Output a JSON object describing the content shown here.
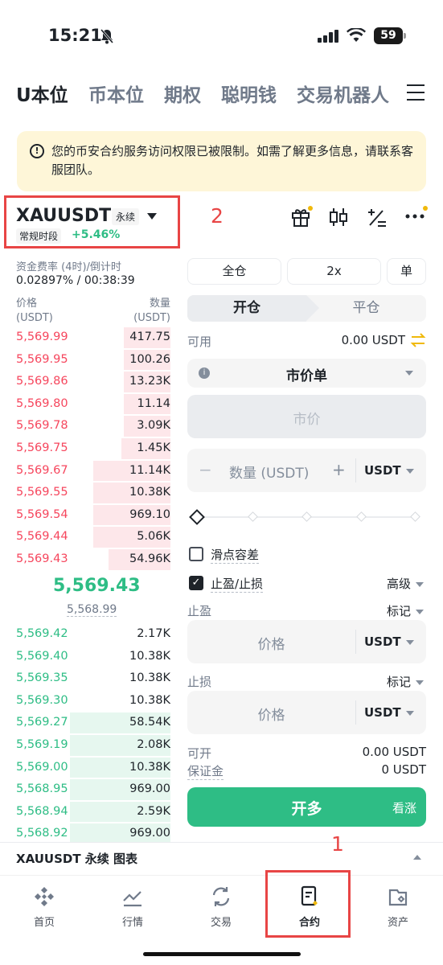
{
  "status_bar": {
    "time": "15:21",
    "battery": "59"
  },
  "top_tabs": [
    "U本位",
    "币本位",
    "期权",
    "聪明钱",
    "交易机器人"
  ],
  "notice": {
    "text": "您的币安合约服务访问权限已被限制。如需了解更多信息，请联系客服团队。"
  },
  "symbol": {
    "name": "XAUUSDT",
    "type": "永续",
    "session": "常规时段",
    "change": "+5.46%"
  },
  "annotations": {
    "label_2": "2",
    "label_1": "1"
  },
  "funding": {
    "label": "资金费率 (4时)/倒计时",
    "value": "0.02897% / 00:38:39"
  },
  "orderbook": {
    "price_header": "价格",
    "price_unit": "(USDT)",
    "qty_header": "数量",
    "qty_unit": "(USDT)",
    "asks": [
      {
        "price": "5,569.99",
        "qty": "417.75",
        "depth": 0.3
      },
      {
        "price": "5,569.95",
        "qty": "100.26",
        "depth": 0.3
      },
      {
        "price": "5,569.86",
        "qty": "13.23K",
        "depth": 0.3
      },
      {
        "price": "5,569.80",
        "qty": "11.14",
        "depth": 0.3
      },
      {
        "price": "5,569.78",
        "qty": "3.09K",
        "depth": 0.3
      },
      {
        "price": "5,569.75",
        "qty": "1.45K",
        "depth": 0.32
      },
      {
        "price": "5,569.67",
        "qty": "11.14K",
        "depth": 0.5
      },
      {
        "price": "5,569.55",
        "qty": "10.38K",
        "depth": 0.5
      },
      {
        "price": "5,569.54",
        "qty": "969.10",
        "depth": 0.5
      },
      {
        "price": "5,569.44",
        "qty": "5.06K",
        "depth": 0.5
      },
      {
        "price": "5,569.43",
        "qty": "54.96K",
        "depth": 0.4
      }
    ],
    "mid_price": "5,569.43",
    "mark_price": "5,568.99",
    "bids": [
      {
        "price": "5,569.42",
        "qty": "2.17K",
        "depth": 0
      },
      {
        "price": "5,569.40",
        "qty": "10.38K",
        "depth": 0
      },
      {
        "price": "5,569.35",
        "qty": "10.38K",
        "depth": 0
      },
      {
        "price": "5,569.30",
        "qty": "10.38K",
        "depth": 0
      },
      {
        "price": "5,569.27",
        "qty": "58.54K",
        "depth": 0.65
      },
      {
        "price": "5,569.19",
        "qty": "2.08K",
        "depth": 0.65
      },
      {
        "price": "5,569.00",
        "qty": "10.38K",
        "depth": 0.65
      },
      {
        "price": "5,568.95",
        "qty": "969.00",
        "depth": 0.65
      },
      {
        "price": "5,568.94",
        "qty": "2.59K",
        "depth": 0.65
      },
      {
        "price": "5,568.92",
        "qty": "969.00",
        "depth": 0.65
      }
    ]
  },
  "trade": {
    "margin_mode": "全仓",
    "leverage": "2x",
    "position_mode": "单",
    "open_tab": "开仓",
    "close_tab": "平仓",
    "available_label": "可用",
    "available_value": "0.00 USDT",
    "order_type": "市价单",
    "price_placeholder": "市价",
    "qty_placeholder": "数量 (USDT)",
    "qty_unit": "USDT",
    "slippage_label": "滑点容差",
    "tpsl_label": "止盈/止损",
    "advanced_label": "高级",
    "tp_label": "止盈",
    "tp_mark": "标记",
    "tp_price": "价格",
    "tp_unit": "USDT",
    "sl_label": "止损",
    "sl_mark": "标记",
    "sl_price": "价格",
    "sl_unit": "USDT",
    "can_open_label": "可开",
    "can_open_value": "0.00 USDT",
    "margin_label": "保证金",
    "margin_value": "0 USDT",
    "long_button": "开多",
    "long_sub": "看涨"
  },
  "chart_bar": {
    "label": "XAUUSDT 永续 图表"
  },
  "nav": [
    {
      "label": "首页",
      "icon": "home-icon"
    },
    {
      "label": "行情",
      "icon": "markets-icon"
    },
    {
      "label": "交易",
      "icon": "trade-icon"
    },
    {
      "label": "合约",
      "icon": "futures-icon"
    },
    {
      "label": "资产",
      "icon": "wallet-icon"
    }
  ],
  "colors": {
    "up": "#2ebd85",
    "down": "#f6465d",
    "highlight": "#e84545",
    "accent": "#f0b90b"
  }
}
